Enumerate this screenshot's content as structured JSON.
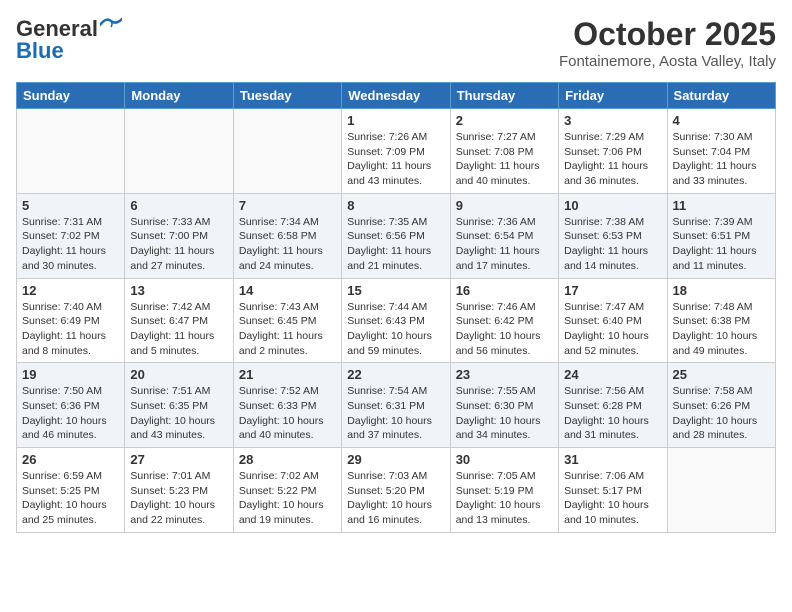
{
  "header": {
    "logo_general": "General",
    "logo_blue": "Blue",
    "month_title": "October 2025",
    "location": "Fontainemore, Aosta Valley, Italy"
  },
  "days_of_week": [
    "Sunday",
    "Monday",
    "Tuesday",
    "Wednesday",
    "Thursday",
    "Friday",
    "Saturday"
  ],
  "weeks": [
    {
      "shaded": false,
      "days": [
        {
          "number": "",
          "info": ""
        },
        {
          "number": "",
          "info": ""
        },
        {
          "number": "",
          "info": ""
        },
        {
          "number": "1",
          "info": "Sunrise: 7:26 AM\nSunset: 7:09 PM\nDaylight: 11 hours\nand 43 minutes."
        },
        {
          "number": "2",
          "info": "Sunrise: 7:27 AM\nSunset: 7:08 PM\nDaylight: 11 hours\nand 40 minutes."
        },
        {
          "number": "3",
          "info": "Sunrise: 7:29 AM\nSunset: 7:06 PM\nDaylight: 11 hours\nand 36 minutes."
        },
        {
          "number": "4",
          "info": "Sunrise: 7:30 AM\nSunset: 7:04 PM\nDaylight: 11 hours\nand 33 minutes."
        }
      ]
    },
    {
      "shaded": true,
      "days": [
        {
          "number": "5",
          "info": "Sunrise: 7:31 AM\nSunset: 7:02 PM\nDaylight: 11 hours\nand 30 minutes."
        },
        {
          "number": "6",
          "info": "Sunrise: 7:33 AM\nSunset: 7:00 PM\nDaylight: 11 hours\nand 27 minutes."
        },
        {
          "number": "7",
          "info": "Sunrise: 7:34 AM\nSunset: 6:58 PM\nDaylight: 11 hours\nand 24 minutes."
        },
        {
          "number": "8",
          "info": "Sunrise: 7:35 AM\nSunset: 6:56 PM\nDaylight: 11 hours\nand 21 minutes."
        },
        {
          "number": "9",
          "info": "Sunrise: 7:36 AM\nSunset: 6:54 PM\nDaylight: 11 hours\nand 17 minutes."
        },
        {
          "number": "10",
          "info": "Sunrise: 7:38 AM\nSunset: 6:53 PM\nDaylight: 11 hours\nand 14 minutes."
        },
        {
          "number": "11",
          "info": "Sunrise: 7:39 AM\nSunset: 6:51 PM\nDaylight: 11 hours\nand 11 minutes."
        }
      ]
    },
    {
      "shaded": false,
      "days": [
        {
          "number": "12",
          "info": "Sunrise: 7:40 AM\nSunset: 6:49 PM\nDaylight: 11 hours\nand 8 minutes."
        },
        {
          "number": "13",
          "info": "Sunrise: 7:42 AM\nSunset: 6:47 PM\nDaylight: 11 hours\nand 5 minutes."
        },
        {
          "number": "14",
          "info": "Sunrise: 7:43 AM\nSunset: 6:45 PM\nDaylight: 11 hours\nand 2 minutes."
        },
        {
          "number": "15",
          "info": "Sunrise: 7:44 AM\nSunset: 6:43 PM\nDaylight: 10 hours\nand 59 minutes."
        },
        {
          "number": "16",
          "info": "Sunrise: 7:46 AM\nSunset: 6:42 PM\nDaylight: 10 hours\nand 56 minutes."
        },
        {
          "number": "17",
          "info": "Sunrise: 7:47 AM\nSunset: 6:40 PM\nDaylight: 10 hours\nand 52 minutes."
        },
        {
          "number": "18",
          "info": "Sunrise: 7:48 AM\nSunset: 6:38 PM\nDaylight: 10 hours\nand 49 minutes."
        }
      ]
    },
    {
      "shaded": true,
      "days": [
        {
          "number": "19",
          "info": "Sunrise: 7:50 AM\nSunset: 6:36 PM\nDaylight: 10 hours\nand 46 minutes."
        },
        {
          "number": "20",
          "info": "Sunrise: 7:51 AM\nSunset: 6:35 PM\nDaylight: 10 hours\nand 43 minutes."
        },
        {
          "number": "21",
          "info": "Sunrise: 7:52 AM\nSunset: 6:33 PM\nDaylight: 10 hours\nand 40 minutes."
        },
        {
          "number": "22",
          "info": "Sunrise: 7:54 AM\nSunset: 6:31 PM\nDaylight: 10 hours\nand 37 minutes."
        },
        {
          "number": "23",
          "info": "Sunrise: 7:55 AM\nSunset: 6:30 PM\nDaylight: 10 hours\nand 34 minutes."
        },
        {
          "number": "24",
          "info": "Sunrise: 7:56 AM\nSunset: 6:28 PM\nDaylight: 10 hours\nand 31 minutes."
        },
        {
          "number": "25",
          "info": "Sunrise: 7:58 AM\nSunset: 6:26 PM\nDaylight: 10 hours\nand 28 minutes."
        }
      ]
    },
    {
      "shaded": false,
      "days": [
        {
          "number": "26",
          "info": "Sunrise: 6:59 AM\nSunset: 5:25 PM\nDaylight: 10 hours\nand 25 minutes."
        },
        {
          "number": "27",
          "info": "Sunrise: 7:01 AM\nSunset: 5:23 PM\nDaylight: 10 hours\nand 22 minutes."
        },
        {
          "number": "28",
          "info": "Sunrise: 7:02 AM\nSunset: 5:22 PM\nDaylight: 10 hours\nand 19 minutes."
        },
        {
          "number": "29",
          "info": "Sunrise: 7:03 AM\nSunset: 5:20 PM\nDaylight: 10 hours\nand 16 minutes."
        },
        {
          "number": "30",
          "info": "Sunrise: 7:05 AM\nSunset: 5:19 PM\nDaylight: 10 hours\nand 13 minutes."
        },
        {
          "number": "31",
          "info": "Sunrise: 7:06 AM\nSunset: 5:17 PM\nDaylight: 10 hours\nand 10 minutes."
        },
        {
          "number": "",
          "info": ""
        }
      ]
    }
  ]
}
